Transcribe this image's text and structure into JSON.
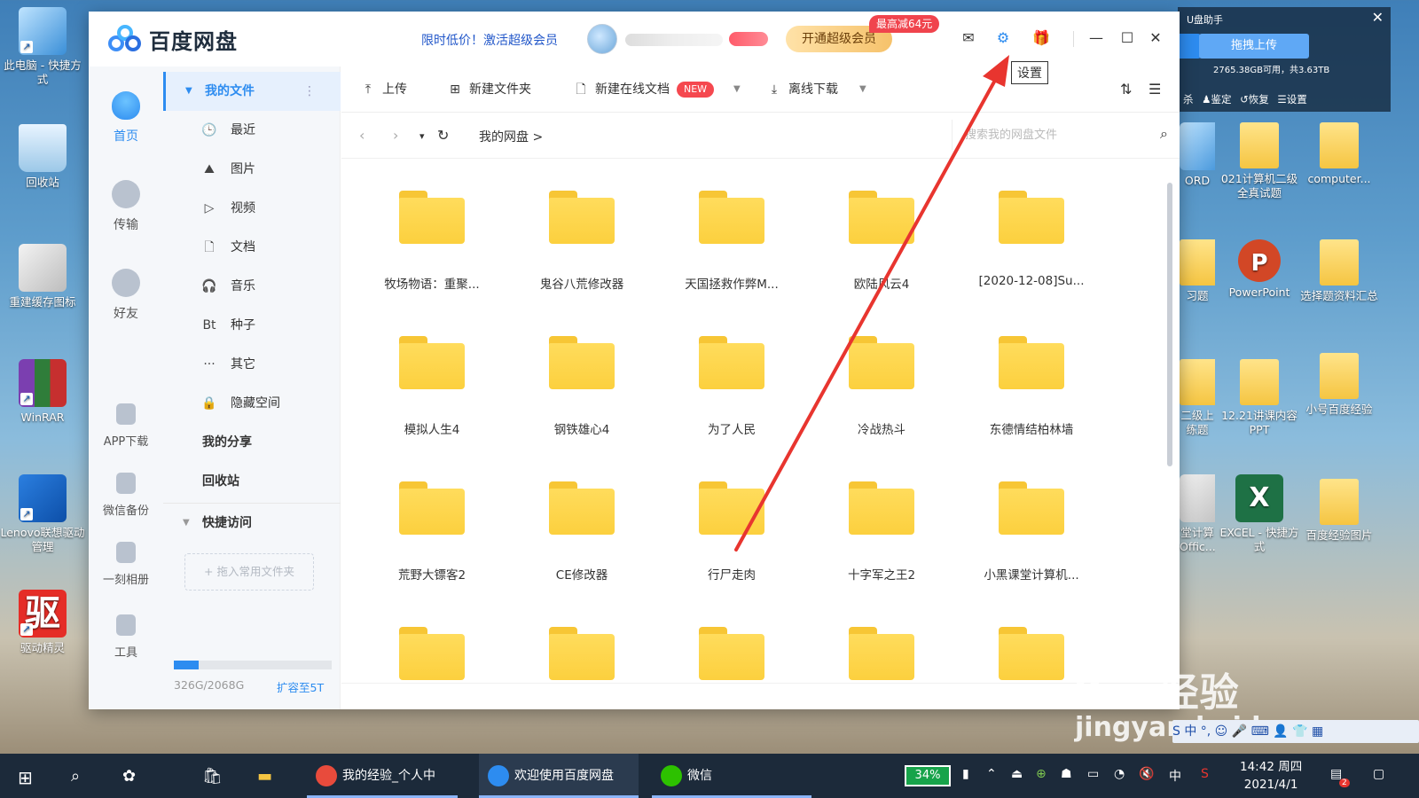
{
  "desktop_left": [
    {
      "label": "此电脑 - 快捷方式",
      "icon": "computer-icon"
    },
    {
      "label": "回收站",
      "icon": "recycle-bin-icon"
    },
    {
      "label": "重建缓存图标",
      "icon": "gear-icon"
    },
    {
      "label": "WinRAR",
      "icon": "winrar-icon"
    },
    {
      "label": "Lenovo联想驱动管理",
      "icon": "lenovo-driver-icon"
    },
    {
      "label": "驱动精灵",
      "icon": "driver-genius-icon",
      "glyph": "驱"
    }
  ],
  "desktop_right": [
    {
      "label": "ORD",
      "icon": "word-doc-icon"
    },
    {
      "label": "021计算机二级全真试题",
      "icon": "folder-icon"
    },
    {
      "label": "computer...",
      "icon": "folder-icon"
    },
    {
      "label": "习题",
      "icon": "folder-icon"
    },
    {
      "label": "PowerPoint",
      "icon": "powerpoint-icon",
      "glyph": "P"
    },
    {
      "label": "选择题资料汇总",
      "icon": "folder-icon"
    },
    {
      "label": "二级上 练题",
      "icon": "folder-icon"
    },
    {
      "label": "12.21讲课内容PPT",
      "icon": "folder-icon"
    },
    {
      "label": "小号百度经验",
      "icon": "folder-icon"
    },
    {
      "label": "堂计算 Offic...",
      "icon": "app-icon"
    },
    {
      "label": "EXCEL - 快捷方式",
      "icon": "excel-icon",
      "glyph": "X"
    },
    {
      "label": "百度经验图片",
      "icon": "folder-icon"
    }
  ],
  "mini_widget": {
    "title": "U盘助手",
    "close": "✕",
    "upload": "拖拽上传",
    "space": "2765.38GB可用，共3.63TB",
    "actions": "杀 ♟鉴定 ↺恢复 ☰设置"
  },
  "window": {
    "app_name": "百度网盘",
    "promo": "限时低价！激活超级会员",
    "vip_button": "开通超级会员",
    "vip_tag": "最高减64元",
    "tooltip": "设置",
    "icons": {
      "mail": "✉",
      "settings": "⚙",
      "gift": "🎁",
      "minimize": "—",
      "maximize": "☐",
      "close": "✕"
    }
  },
  "rail": [
    {
      "label": "首页",
      "active": true
    },
    {
      "label": "传输"
    },
    {
      "label": "好友"
    },
    {
      "label": "APP下载"
    },
    {
      "label": "微信备份"
    },
    {
      "label": "一刻相册"
    },
    {
      "label": "工具"
    }
  ],
  "nav": {
    "my_files": "我的文件",
    "more": "⋮",
    "items": [
      {
        "label": "最近",
        "icon": "🕒"
      },
      {
        "label": "图片",
        "icon": "⛰"
      },
      {
        "label": "视频",
        "icon": "▷"
      },
      {
        "label": "文档",
        "icon": "🗋"
      },
      {
        "label": "音乐",
        "icon": "🎧"
      },
      {
        "label": "种子",
        "icon": "Bt"
      },
      {
        "label": "其它",
        "icon": "···"
      },
      {
        "label": "隐藏空间",
        "icon": "🔒"
      }
    ],
    "my_share": "我的分享",
    "recycle": "回收站",
    "quick_access": "快捷访问",
    "dropzone": "+ 拖入常用文件夹",
    "quota_text": "326G/2068G",
    "quota_used_fraction": 0.158,
    "expand": "扩容至5T"
  },
  "toolbar": {
    "upload": "上传",
    "new_folder": "新建文件夹",
    "new_doc": "新建在线文档",
    "new_badge": "NEW",
    "offline": "离线下载",
    "sort_icon": "⇅",
    "list_icon": "☰"
  },
  "address": {
    "back": "‹",
    "forward": "›",
    "dropdown": "▾",
    "refresh": "↻",
    "crumb": "我的网盘  >",
    "search_placeholder": "搜索我的网盘文件",
    "search_icon": "⌕"
  },
  "files": [
    "牧场物语：重聚...",
    "鬼谷八荒修改器",
    "天国拯救作弊M...",
    "欧陆风云4",
    "[2020-12-08]Su...",
    "模拟人生4",
    "钢铁雄心4",
    "为了人民",
    "冷战热斗",
    "东德情结柏林墙",
    "荒野大镖客2",
    "CE修改器",
    "行尸走肉",
    "十字军之王2",
    "小黑课堂计算机...",
    "",
    "",
    "",
    "",
    ""
  ],
  "watermark": {
    "line1": "Bai 经验",
    "line2": "jingyan.baidu.com"
  },
  "ime": "S 中 °, ☺ 🎤 ⌨ 👤 👕 ▦",
  "taskbar": {
    "apps": [
      {
        "label": "我的经验_个人中心...",
        "color": "#e84b3c"
      },
      {
        "label": "欢迎使用百度网盘",
        "color": "#2d8cf0"
      },
      {
        "label": "微信",
        "color": "#2dc100"
      }
    ],
    "battery": "34%",
    "lang": "中",
    "time": "14:42 周四",
    "date": "2021/4/1",
    "notify_count": "2"
  }
}
